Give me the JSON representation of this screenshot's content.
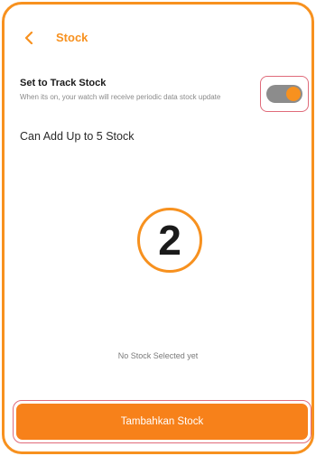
{
  "header": {
    "back_icon": "chevron-left-icon",
    "title": "Stock"
  },
  "track": {
    "title": "Set to Track Stock",
    "description": "When its on, your watch will receive periodic data stock update",
    "toggle_on": true
  },
  "limit_text": "Can Add Up to 5 Stock",
  "step_badge": "2",
  "empty_state": "No Stock Selected yet",
  "add_button": {
    "label": "Tambahkan Stock"
  },
  "colors": {
    "accent": "#f7911f",
    "button": "#f7811a",
    "highlight_border": "#e06b7a",
    "toggle_track": "#8c8c8c"
  }
}
